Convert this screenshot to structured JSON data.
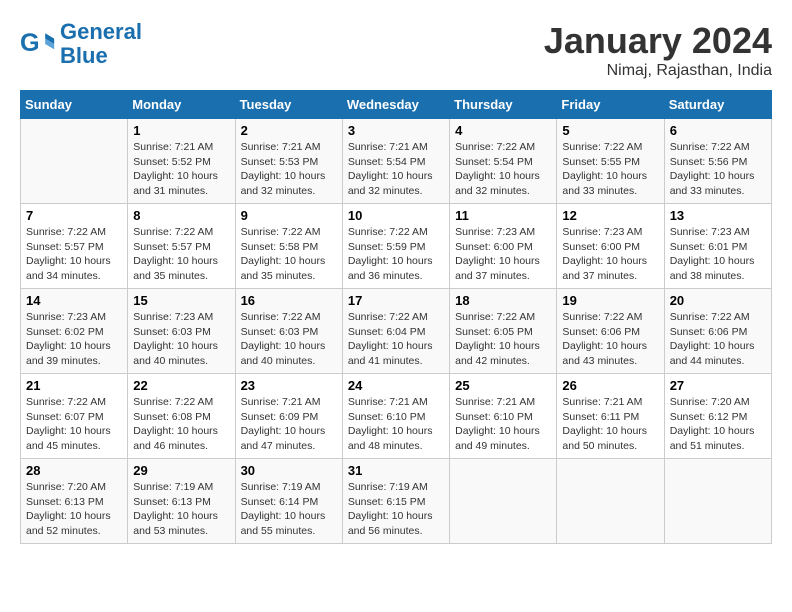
{
  "header": {
    "logo_line1": "General",
    "logo_line2": "Blue",
    "month": "January 2024",
    "location": "Nimaj, Rajasthan, India"
  },
  "weekdays": [
    "Sunday",
    "Monday",
    "Tuesday",
    "Wednesday",
    "Thursday",
    "Friday",
    "Saturday"
  ],
  "weeks": [
    [
      {
        "day": "",
        "content": ""
      },
      {
        "day": "1",
        "content": "Sunrise: 7:21 AM\nSunset: 5:52 PM\nDaylight: 10 hours\nand 31 minutes."
      },
      {
        "day": "2",
        "content": "Sunrise: 7:21 AM\nSunset: 5:53 PM\nDaylight: 10 hours\nand 32 minutes."
      },
      {
        "day": "3",
        "content": "Sunrise: 7:21 AM\nSunset: 5:54 PM\nDaylight: 10 hours\nand 32 minutes."
      },
      {
        "day": "4",
        "content": "Sunrise: 7:22 AM\nSunset: 5:54 PM\nDaylight: 10 hours\nand 32 minutes."
      },
      {
        "day": "5",
        "content": "Sunrise: 7:22 AM\nSunset: 5:55 PM\nDaylight: 10 hours\nand 33 minutes."
      },
      {
        "day": "6",
        "content": "Sunrise: 7:22 AM\nSunset: 5:56 PM\nDaylight: 10 hours\nand 33 minutes."
      }
    ],
    [
      {
        "day": "7",
        "content": "Sunrise: 7:22 AM\nSunset: 5:57 PM\nDaylight: 10 hours\nand 34 minutes."
      },
      {
        "day": "8",
        "content": "Sunrise: 7:22 AM\nSunset: 5:57 PM\nDaylight: 10 hours\nand 35 minutes."
      },
      {
        "day": "9",
        "content": "Sunrise: 7:22 AM\nSunset: 5:58 PM\nDaylight: 10 hours\nand 35 minutes."
      },
      {
        "day": "10",
        "content": "Sunrise: 7:22 AM\nSunset: 5:59 PM\nDaylight: 10 hours\nand 36 minutes."
      },
      {
        "day": "11",
        "content": "Sunrise: 7:23 AM\nSunset: 6:00 PM\nDaylight: 10 hours\nand 37 minutes."
      },
      {
        "day": "12",
        "content": "Sunrise: 7:23 AM\nSunset: 6:00 PM\nDaylight: 10 hours\nand 37 minutes."
      },
      {
        "day": "13",
        "content": "Sunrise: 7:23 AM\nSunset: 6:01 PM\nDaylight: 10 hours\nand 38 minutes."
      }
    ],
    [
      {
        "day": "14",
        "content": "Sunrise: 7:23 AM\nSunset: 6:02 PM\nDaylight: 10 hours\nand 39 minutes."
      },
      {
        "day": "15",
        "content": "Sunrise: 7:23 AM\nSunset: 6:03 PM\nDaylight: 10 hours\nand 40 minutes."
      },
      {
        "day": "16",
        "content": "Sunrise: 7:22 AM\nSunset: 6:03 PM\nDaylight: 10 hours\nand 40 minutes."
      },
      {
        "day": "17",
        "content": "Sunrise: 7:22 AM\nSunset: 6:04 PM\nDaylight: 10 hours\nand 41 minutes."
      },
      {
        "day": "18",
        "content": "Sunrise: 7:22 AM\nSunset: 6:05 PM\nDaylight: 10 hours\nand 42 minutes."
      },
      {
        "day": "19",
        "content": "Sunrise: 7:22 AM\nSunset: 6:06 PM\nDaylight: 10 hours\nand 43 minutes."
      },
      {
        "day": "20",
        "content": "Sunrise: 7:22 AM\nSunset: 6:06 PM\nDaylight: 10 hours\nand 44 minutes."
      }
    ],
    [
      {
        "day": "21",
        "content": "Sunrise: 7:22 AM\nSunset: 6:07 PM\nDaylight: 10 hours\nand 45 minutes."
      },
      {
        "day": "22",
        "content": "Sunrise: 7:22 AM\nSunset: 6:08 PM\nDaylight: 10 hours\nand 46 minutes."
      },
      {
        "day": "23",
        "content": "Sunrise: 7:21 AM\nSunset: 6:09 PM\nDaylight: 10 hours\nand 47 minutes."
      },
      {
        "day": "24",
        "content": "Sunrise: 7:21 AM\nSunset: 6:10 PM\nDaylight: 10 hours\nand 48 minutes."
      },
      {
        "day": "25",
        "content": "Sunrise: 7:21 AM\nSunset: 6:10 PM\nDaylight: 10 hours\nand 49 minutes."
      },
      {
        "day": "26",
        "content": "Sunrise: 7:21 AM\nSunset: 6:11 PM\nDaylight: 10 hours\nand 50 minutes."
      },
      {
        "day": "27",
        "content": "Sunrise: 7:20 AM\nSunset: 6:12 PM\nDaylight: 10 hours\nand 51 minutes."
      }
    ],
    [
      {
        "day": "28",
        "content": "Sunrise: 7:20 AM\nSunset: 6:13 PM\nDaylight: 10 hours\nand 52 minutes."
      },
      {
        "day": "29",
        "content": "Sunrise: 7:19 AM\nSunset: 6:13 PM\nDaylight: 10 hours\nand 53 minutes."
      },
      {
        "day": "30",
        "content": "Sunrise: 7:19 AM\nSunset: 6:14 PM\nDaylight: 10 hours\nand 55 minutes."
      },
      {
        "day": "31",
        "content": "Sunrise: 7:19 AM\nSunset: 6:15 PM\nDaylight: 10 hours\nand 56 minutes."
      },
      {
        "day": "",
        "content": ""
      },
      {
        "day": "",
        "content": ""
      },
      {
        "day": "",
        "content": ""
      }
    ]
  ]
}
